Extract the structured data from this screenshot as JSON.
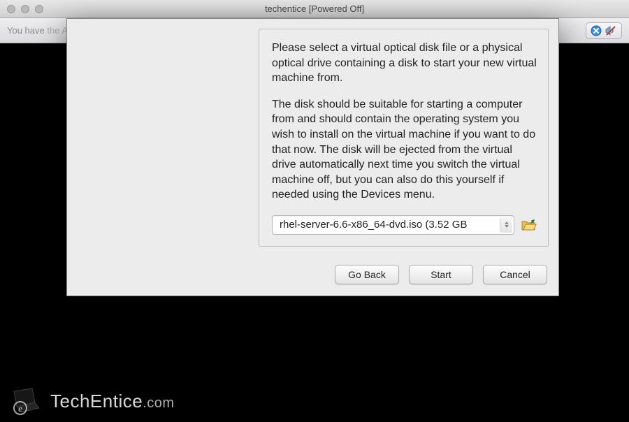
{
  "window": {
    "title": "techentice [Powered Off]"
  },
  "info_bar": {
    "lead": "You have",
    "tail": " the Auto capture keyboard option turned on. This will cause the Virtual Machine to automatically capture"
  },
  "dialog": {
    "paragraph1": "Please select a virtual optical disk file or a physical optical drive containing a disk to start your new virtual machine from.",
    "paragraph2": "The disk should be suitable for starting a computer from and should contain the operating system you wish to install on the virtual machine if you want to do that now. The disk will be ejected from the virtual drive automatically next time you switch the virtual machine off, but you can also do this yourself if needed using the Devices menu.",
    "selected_disk": "rhel-server-6.6-x86_64-dvd.iso (3.52 GB",
    "buttons": {
      "go_back": "Go Back",
      "start": "Start",
      "cancel": "Cancel"
    }
  },
  "watermark": {
    "brand_main": "TechEntice",
    "brand_tld": ".com"
  }
}
